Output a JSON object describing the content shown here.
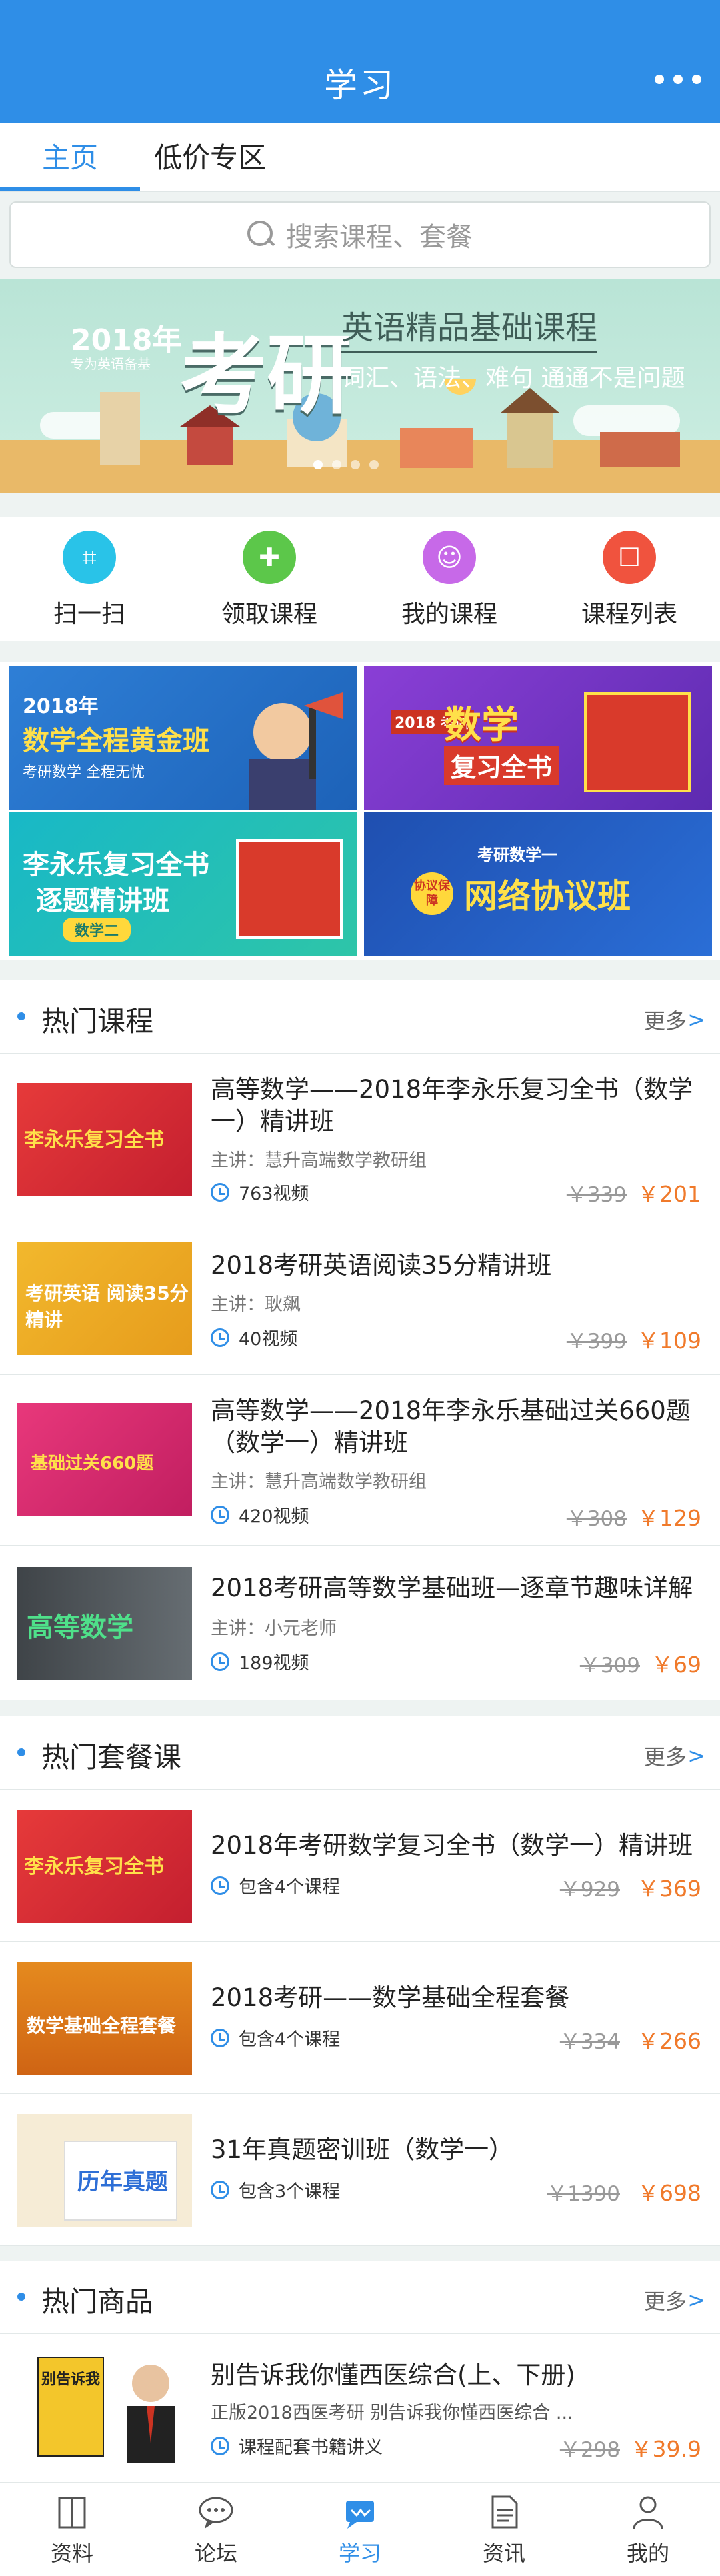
{
  "header": {
    "title": "学习"
  },
  "tabs": [
    {
      "label": "主页",
      "active": true
    },
    {
      "label": "低价专区",
      "active": false
    }
  ],
  "search": {
    "placeholder": "搜索课程、套餐"
  },
  "banner": {
    "year": "2018年",
    "small": "专为英语备基",
    "big": "考研",
    "title": "英语精品基础课程",
    "tagline": "词汇、语法、难句 通通不是问题"
  },
  "quick_actions": [
    {
      "label": "扫一扫",
      "icon": "scan-icon",
      "color": "#29c3e8"
    },
    {
      "label": "领取课程",
      "icon": "gift-icon",
      "color": "#5cc74a"
    },
    {
      "label": "我的课程",
      "icon": "user-icon",
      "color": "#c769e8"
    },
    {
      "label": "课程列表",
      "icon": "bag-icon",
      "color": "#f0533e"
    }
  ],
  "promos": [
    {
      "line1": "2018年",
      "line2": "数学全程黄金班",
      "line3": "考研数学   全程无忧"
    },
    {
      "line1": "2018 考研",
      "line2": "数学",
      "line3": "复习全书"
    },
    {
      "line1": "李永乐复习全书",
      "line2": "逐题精讲班",
      "line3": "数学二"
    },
    {
      "line1": "考研数学一",
      "line2": "网络协议班",
      "line3": "协议保障"
    }
  ],
  "hot_courses": {
    "title": "热门课程",
    "more": "更多",
    "items": [
      {
        "title": "高等数学——2018年李永乐复习全书（数学一）精讲班",
        "teacher": "主讲：慧升高端数学教研组",
        "meta": "763视频",
        "old_price": "￥339",
        "price": "￥201",
        "thumb_text": "李永乐复习全书"
      },
      {
        "title": "2018考研英语阅读35分精讲班",
        "teacher": "主讲：耿飙",
        "meta": "40视频",
        "old_price": "￥399",
        "price": "￥109",
        "thumb_text": "考研英语 阅读35分精讲"
      },
      {
        "title": "高等数学——2018年李永乐基础过关660题（数学一）精讲班",
        "teacher": "主讲：慧升高端数学教研组",
        "meta": "420视频",
        "old_price": "￥308",
        "price": "￥129",
        "thumb_text": "基础过关660题"
      },
      {
        "title": "2018考研高等数学基础班—逐章节趣味详解",
        "teacher": "主讲：小元老师",
        "meta": "189视频",
        "old_price": "￥309",
        "price": "￥69",
        "thumb_text": "高等数学"
      }
    ]
  },
  "hot_packages": {
    "title": "热门套餐课",
    "more": "更多",
    "items": [
      {
        "title": "2018年考研数学复习全书（数学一）精讲班",
        "meta": "包含4个课程",
        "old_price": "￥929",
        "price": "￥369",
        "thumb_text": "李永乐复习全书"
      },
      {
        "title": "2018考研——数学基础全程套餐",
        "meta": "包含4个课程",
        "old_price": "￥334",
        "price": "￥266",
        "thumb_text": "数学基础全程套餐"
      },
      {
        "title": "31年真题密训班（数学一）",
        "meta": "包含3个课程",
        "old_price": "￥1390",
        "price": "￥698",
        "thumb_text": "历年真题"
      }
    ]
  },
  "hot_goods": {
    "title": "热门商品",
    "more": "更多",
    "items": [
      {
        "title": "别告诉我你懂西医综合(上、下册)",
        "subtitle": "正版2018西医考研 别告诉我你懂西医综合 ...",
        "meta": "课程配套书籍讲义",
        "old_price": "￥298",
        "price": "￥39.9",
        "thumb_text": "别告诉我"
      }
    ]
  },
  "bottom_nav": [
    {
      "label": "资料",
      "icon": "book-icon",
      "active": false
    },
    {
      "label": "论坛",
      "icon": "chat-icon",
      "active": false
    },
    {
      "label": "学习",
      "icon": "study-icon",
      "active": true
    },
    {
      "label": "资讯",
      "icon": "news-icon",
      "active": false
    },
    {
      "label": "我的",
      "icon": "person-icon",
      "active": false
    }
  ]
}
